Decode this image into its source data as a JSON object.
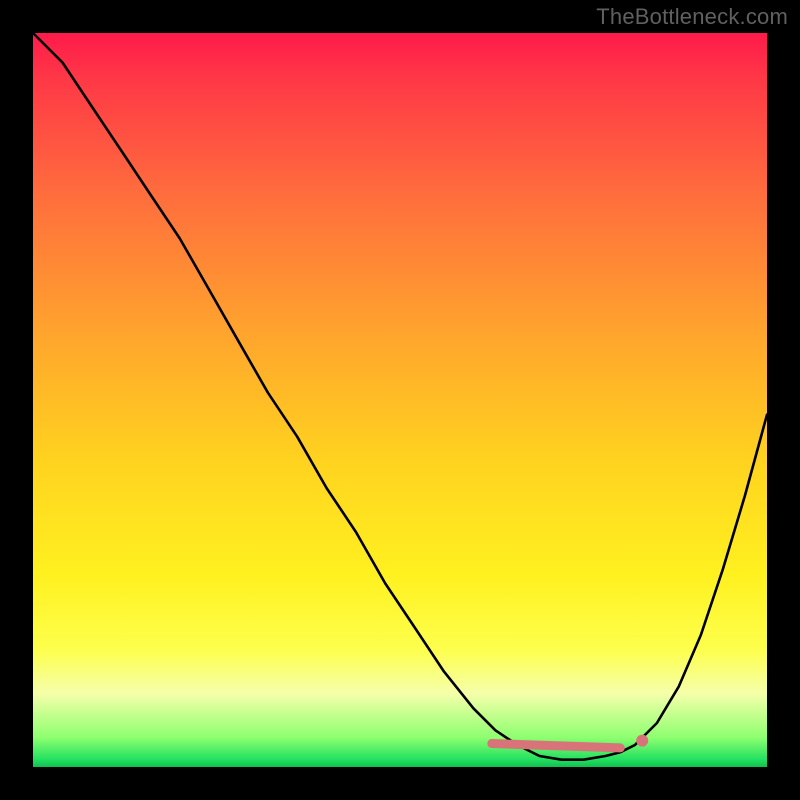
{
  "watermark": "TheBottleneck.com",
  "colors": {
    "background": "#000000",
    "watermark_text": "#606060",
    "curve": "#000000",
    "marker": "#d9737a",
    "gradient_stops": [
      "#ff1a4b",
      "#ff3747",
      "#ff6d3d",
      "#ffa22e",
      "#ffd21f",
      "#fff120",
      "#fdff4d",
      "#f5ffaa",
      "#8dff70",
      "#22e060",
      "#10c050"
    ]
  },
  "chart_data": {
    "type": "line",
    "title": "",
    "xlabel": "",
    "ylabel": "",
    "xlim": [
      0,
      100
    ],
    "ylim": [
      0,
      100
    ],
    "series": [
      {
        "name": "bottleneck-curve",
        "x": [
          0,
          4,
          8,
          12,
          16,
          20,
          24,
          28,
          32,
          36,
          40,
          44,
          48,
          52,
          56,
          60,
          63,
          66,
          69,
          72,
          75,
          78,
          80,
          82,
          85,
          88,
          91,
          94,
          97,
          100
        ],
        "y": [
          100,
          96,
          90,
          84,
          78,
          72,
          65,
          58,
          51,
          45,
          38,
          32,
          25,
          19,
          13,
          8,
          5,
          3,
          1.5,
          1,
          1,
          1.5,
          2,
          3,
          6,
          11,
          18,
          27,
          37,
          48
        ]
      }
    ],
    "markers": {
      "name": "optimal-range",
      "segment_x": [
        62.5,
        80
      ],
      "segment_y": [
        3.2,
        2.6
      ],
      "dot": {
        "x": 83,
        "y": 3.6
      }
    }
  }
}
